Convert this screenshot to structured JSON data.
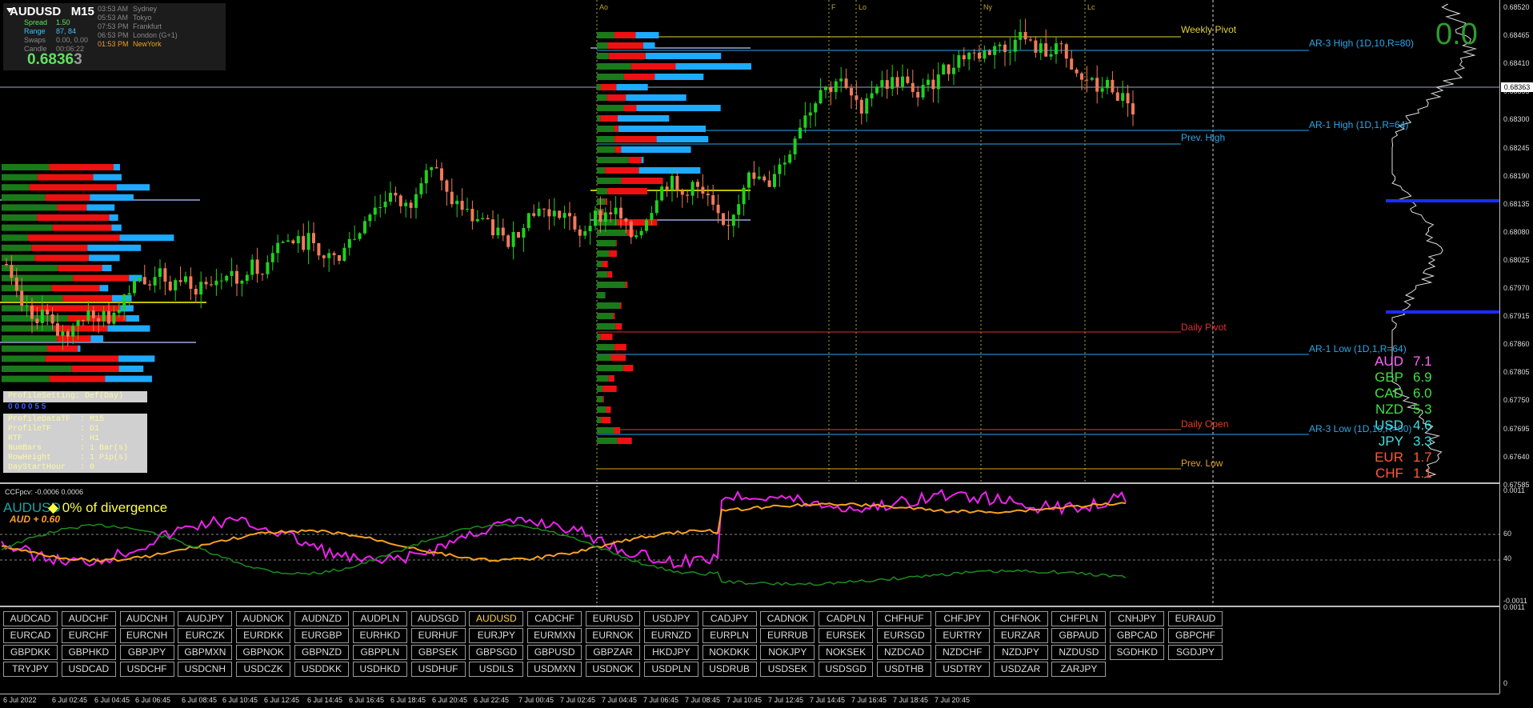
{
  "chart": {
    "symbol": "AUDUSD",
    "timeframe": "M15",
    "info": {
      "spread_label": "Spread",
      "spread_value": "1.50",
      "range_label": "Range",
      "range_value": "87, 84",
      "swaps_label": "Swaps",
      "swaps_value": "0.00, 0.00",
      "candle_label": "Candle",
      "candle_value": "00:06:22",
      "price_main": "0.6836",
      "price_frac": "3"
    },
    "sessions": [
      {
        "time": "03:53 AM",
        "name": "Sydney",
        "color": "#888888"
      },
      {
        "time": "05:53 AM",
        "name": "Tokyo",
        "color": "#888888"
      },
      {
        "time": "07:53 PM",
        "name": "Frankfurt",
        "color": "#888888"
      },
      {
        "time": "06:53 PM",
        "name": "London  (G+1)",
        "color": "#888888"
      },
      {
        "time": "01:53 PM",
        "name": "NewYork",
        "color": "#e8a020"
      }
    ],
    "current_price_tag": "0.68363",
    "top_right_value": "0.0",
    "session_markers": [
      "Ao",
      "F",
      "Lo",
      "Ny",
      "Lc"
    ],
    "levels": [
      {
        "label": "Weekly Pivot",
        "color": "#e0d040"
      },
      {
        "label": "AR-3 High  (1D,10,R=80)",
        "color": "#2aa8e8"
      },
      {
        "label": "AR-1 High  (1D,1,R=64)",
        "color": "#2aa8e8"
      },
      {
        "label": "Prev. High",
        "color": "#2aa8e8"
      },
      {
        "label": "Daily Pivot",
        "color": "#e03030"
      },
      {
        "label": "AR-1 Low  (1D,1,R=64)",
        "color": "#2aa8e8"
      },
      {
        "label": "Daily Open",
        "color": "#e04020"
      },
      {
        "label": "AR-3 Low  (1D,10,R=80)",
        "color": "#2aa8e8"
      },
      {
        "label": "Prev. Low",
        "color": "#e0a020"
      }
    ],
    "strength": [
      {
        "cur": "AUD",
        "val": "7.1",
        "color": "#ff66ff"
      },
      {
        "cur": "GBP",
        "val": "6.9",
        "color": "#40e040"
      },
      {
        "cur": "CAD",
        "val": "6.0",
        "color": "#40e040"
      },
      {
        "cur": "NZD",
        "val": "5.3",
        "color": "#40e040"
      },
      {
        "cur": "USD",
        "val": "4.6",
        "color": "#40e0e0"
      },
      {
        "cur": "JPY",
        "val": "3.3",
        "color": "#40e0e0"
      },
      {
        "cur": "EUR",
        "val": "1.7",
        "color": "#ff5a3a"
      },
      {
        "cur": "CHF",
        "val": "1.1",
        "color": "#ff5a3a"
      }
    ],
    "settings": {
      "header": "ProfileSetting: Def(Day)",
      "lines": [
        "ProfileDataTF  : M15",
        "ProfileTF      : D1",
        "RTF            : H1",
        "NumBars        : 1 Bar(s)",
        "RowHeight      : 1 Pip(s)",
        "DayStartHour   : 0"
      ],
      "dots_label": "0 0 0 0 5 5"
    },
    "price_axis": [
      "0.68520",
      "0.68465",
      "0.68410",
      "0.68355",
      "0.68300",
      "0.68245",
      "0.68190",
      "0.68135",
      "0.68080",
      "0.68025",
      "0.67970",
      "0.67915",
      "0.67860",
      "0.67805",
      "0.67750",
      "0.67695",
      "0.67640",
      "0.67585"
    ]
  },
  "indicator": {
    "title": "CCFpcv: -0.0006 0.0006",
    "aud_text": "AUDUSD",
    "divergence_text": "0% of divergence",
    "aud_value": "AUD + 0.60",
    "axis": [
      "0.0011",
      "60",
      "40",
      "-0.0011"
    ]
  },
  "bottom_axis": [
    "0.0011",
    "0"
  ],
  "pairs": [
    [
      "AUDCAD",
      "AUDCHF",
      "AUDCNH",
      "AUDJPY",
      "AUDNOK",
      "AUDNZD",
      "AUDPLN",
      "AUDSGD",
      "AUDUSD",
      "CADCHF",
      "EURUSD",
      "USDJPY",
      "CADJPY",
      "CADNOK",
      "CADPLN",
      "CHFHUF",
      "CHFJPY",
      "CHFNOK",
      "CHFPLN",
      "CNHJPY",
      "EURAUD"
    ],
    [
      "EURCAD",
      "EURCHF",
      "EURCNH",
      "EURCZK",
      "EURDKK",
      "EURGBP",
      "EURHKD",
      "EURHUF",
      "EURJPY",
      "EURMXN",
      "EURNOK",
      "EURNZD",
      "EURPLN",
      "EURRUB",
      "EURSEK",
      "EURSGD",
      "EURTRY",
      "EURZAR",
      "GBPAUD",
      "GBPCAD",
      "GBPCHF"
    ],
    [
      "GBPDKK",
      "GBPHKD",
      "GBPJPY",
      "GBPMXN",
      "GBPNOK",
      "GBPNZD",
      "GBPPLN",
      "GBPSEK",
      "GBPSGD",
      "GBPUSD",
      "GBPZAR",
      "HKDJPY",
      "NOKDKK",
      "NOKJPY",
      "NOKSEK",
      "NZDCAD",
      "NZDCHF",
      "NZDJPY",
      "NZDUSD",
      "SGDHKD",
      "SGDJPY"
    ],
    [
      "TRYJPY",
      "USDCAD",
      "USDCHF",
      "USDCNH",
      "USDCZK",
      "USDDKK",
      "USDHKD",
      "USDHUF",
      "USDILS",
      "USDMXN",
      "USDNOK",
      "USDPLN",
      "USDRUB",
      "USDSEK",
      "USDSGD",
      "USDTHB",
      "USDTRY",
      "USDZAR",
      "ZARJPY"
    ]
  ],
  "active_pair": "AUDUSD",
  "time_axis": [
    "6 Jul 2022",
    "6 Jul 02:45",
    "6 Jul 04:45",
    "6 Jul 06:45",
    "6 Jul 08:45",
    "6 Jul 10:45",
    "6 Jul 12:45",
    "6 Jul 14:45",
    "6 Jul 16:45",
    "6 Jul 18:45",
    "6 Jul 20:45",
    "6 Jul 22:45",
    "7 Jul 00:45",
    "7 Jul 02:45",
    "7 Jul 04:45",
    "7 Jul 06:45",
    "7 Jul 08:45",
    "7 Jul 10:45",
    "7 Jul 12:45",
    "7 Jul 14:45",
    "7 Jul 16:45",
    "7 Jul 18:45",
    "7 Jul 20:45"
  ]
}
